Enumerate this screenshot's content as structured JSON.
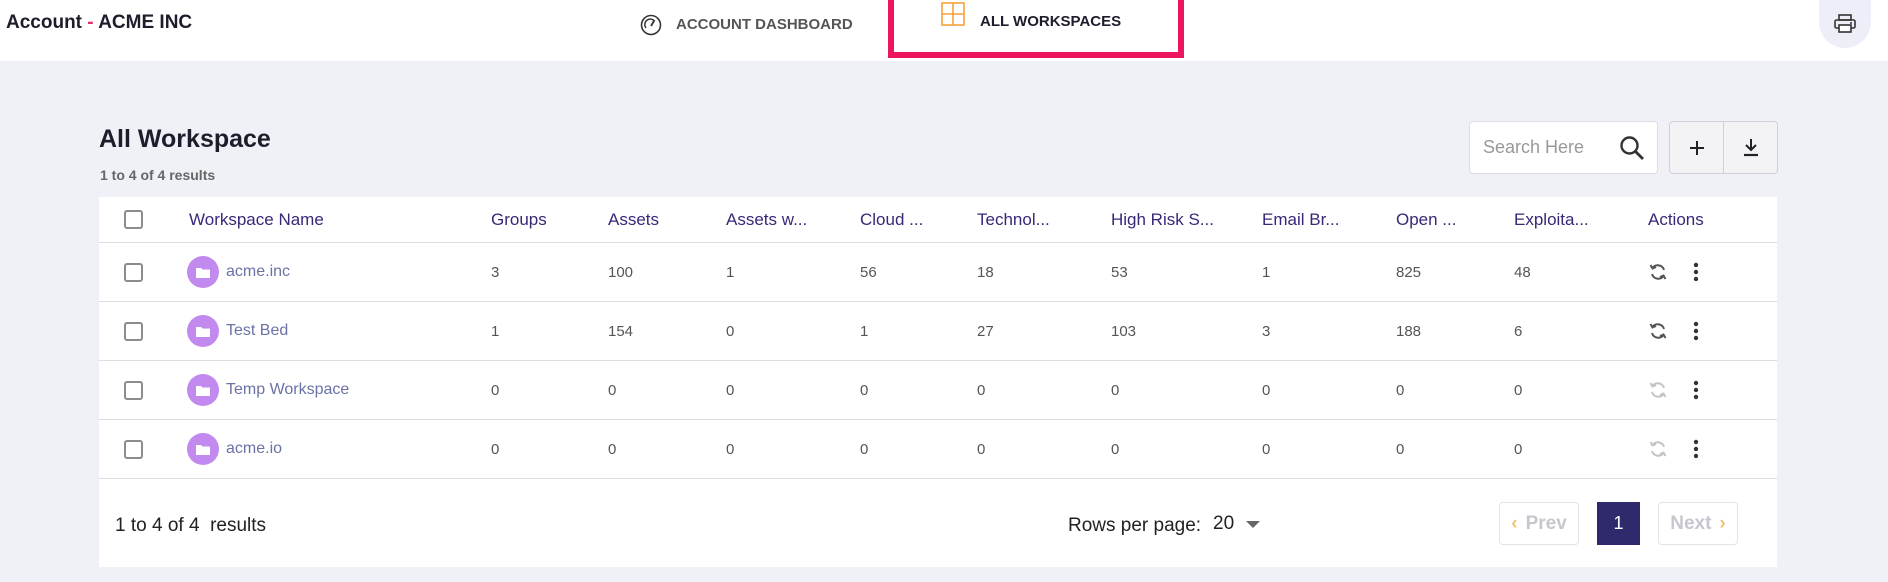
{
  "header": {
    "account_label": "Account",
    "separator": "-",
    "account_name": "ACME INC",
    "tabs": [
      {
        "label": "ACCOUNT DASHBOARD",
        "icon": "gauge-icon"
      },
      {
        "label": "ALL WORKSPACES",
        "icon": "grid-icon",
        "active": true
      }
    ],
    "print_icon": "printer-icon"
  },
  "page": {
    "title": "All Workspace",
    "result_summary": "1 to 4 of 4 results"
  },
  "toolbar": {
    "search_placeholder": "Search Here",
    "search_value": "",
    "add_icon": "plus-icon",
    "download_icon": "download-icon"
  },
  "table": {
    "columns": [
      "Workspace Name",
      "Groups",
      "Assets",
      "Assets w...",
      "Cloud ...",
      "Technol...",
      "High Risk S...",
      "Email Br...",
      "Open ...",
      "Exploita...",
      "Actions"
    ],
    "rows": [
      {
        "name": "acme.inc",
        "values": [
          "3",
          "100",
          "1",
          "56",
          "18",
          "53",
          "1",
          "825",
          "48"
        ],
        "sync_enabled": true
      },
      {
        "name": "Test Bed",
        "values": [
          "1",
          "154",
          "0",
          "1",
          "27",
          "103",
          "3",
          "188",
          "6"
        ],
        "sync_enabled": true
      },
      {
        "name": "Temp Workspace",
        "values": [
          "0",
          "0",
          "0",
          "0",
          "0",
          "0",
          "0",
          "0",
          "0"
        ],
        "sync_enabled": false
      },
      {
        "name": "acme.io",
        "values": [
          "0",
          "0",
          "0",
          "0",
          "0",
          "0",
          "0",
          "0",
          "0"
        ],
        "sync_enabled": false
      }
    ]
  },
  "footer": {
    "count_text": "1 to 4 of 4",
    "results_word": "results",
    "rows_per_page_label": "Rows per page:",
    "rows_per_page_value": "20",
    "prev_label": "Prev",
    "next_label": "Next",
    "current_page": "1"
  },
  "colors": {
    "accent": "#2e2a6c",
    "highlight_border": "#ee1560",
    "header_text": "#3a2778",
    "folder_icon_bg": "#c289ef",
    "tab_icon": "#f5a23a"
  }
}
